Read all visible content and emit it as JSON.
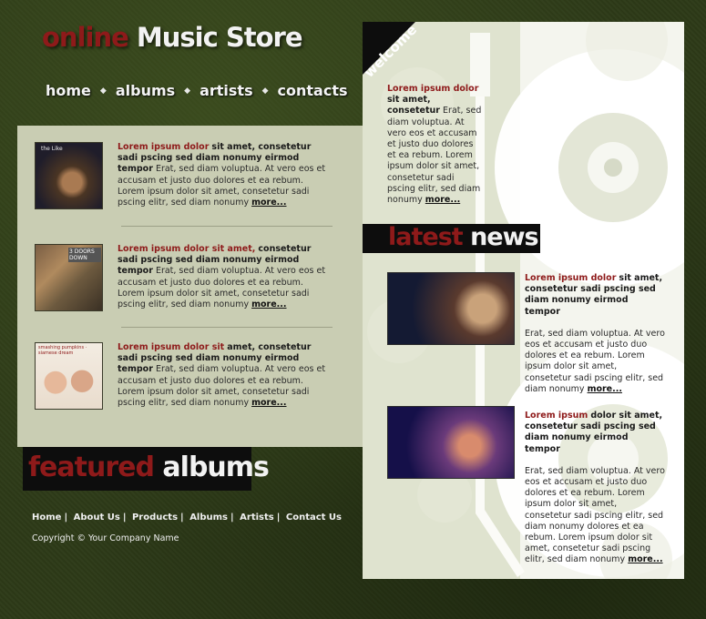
{
  "logo": {
    "part1": "online",
    "part2": "Music Store"
  },
  "nav": {
    "home": "home",
    "albums": "albums",
    "artists": "artists",
    "contacts": "contacts"
  },
  "albums": [
    {
      "title_red": "Lorem ipsum dolor",
      "title_bold": "sit amet, consetetur sadi pscing sed diam nonumy eirmod tempor",
      "body": "Erat, sed diam voluptua. At vero eos et accusam et justo duo dolores et ea rebum. Lorem ipsum dolor sit amet, consetetur sadi pscing elitr, sed diam nonumy",
      "more": "more...",
      "cover_text": "the Like"
    },
    {
      "title_red": "Lorem ipsum dolor sit amet,",
      "title_bold": "consetetur sadi pscing sed diam nonumy eirmod tempor",
      "body": "Erat, sed diam voluptua. At vero eos et accusam et justo duo dolores et ea rebum. Lorem ipsum dolor sit amet, consetetur sadi pscing elitr, sed diam nonumy",
      "more": "more...",
      "cover_text": "3 DOORS DOWN"
    },
    {
      "title_red": "Lorem ipsum dolor sit",
      "title_bold": "amet, consetetur sadi pscing sed diam nonumy eirmod tempor",
      "body": "Erat, sed diam voluptua. At vero eos et accusam et justo duo dolores et ea rebum. Lorem ipsum dolor sit amet, consetetur sadi pscing elitr, sed diam nonumy",
      "more": "more...",
      "cover_text": "smashing pumpkins · siamese dream"
    }
  ],
  "featured": {
    "part1": "featured",
    "part2": "albums"
  },
  "footer": {
    "links": [
      "Home",
      "About Us",
      "Products",
      "Albums",
      "Artists",
      "Contact Us"
    ],
    "copyright": "Copyright © Your Company Name"
  },
  "welcome": {
    "tab": "welcome",
    "title_red": "Lorem ipsum dolor",
    "title_bold": "sit amet, consetetur",
    "body": "Erat, sed diam voluptua. At vero eos et accusam et justo duo dolores et ea rebum. Lorem ipsum dolor sit amet, consetetur sadi pscing elitr, sed diam nonumy",
    "more": "more..."
  },
  "latest_news": {
    "part1": "latest",
    "part2": "news"
  },
  "news": [
    {
      "title_red": "Lorem ipsum dolor",
      "title_bold": "sit amet, consetetur sadi pscing sed diam nonumy eirmod tempor",
      "body": "Erat, sed diam voluptua. At vero eos et accusam et justo duo dolores et ea rebum. Lorem ipsum dolor sit amet, consetetur sadi pscing elitr, sed diam nonumy",
      "more": "more..."
    },
    {
      "title_red": "Lorem ipsum",
      "title_bold": "dolor sit amet, consetetur sadi pscing sed diam nonumy eirmod tempor",
      "body": "Erat, sed diam voluptua. At vero eos et accusam et justo duo dolores et ea rebum. Lorem ipsum dolor sit amet, consetetur sadi pscing elitr, sed diam nonumy dolores et ea rebum. Lorem ipsum dolor sit amet, consetetur sadi pscing elitr, sed diam nonumy",
      "more": "more..."
    }
  ],
  "colors": {
    "accent_red": "#8e1a1a",
    "panel": "#c9cdb3",
    "right_panel": "#dfe3cf",
    "background": "#2d3a18"
  }
}
